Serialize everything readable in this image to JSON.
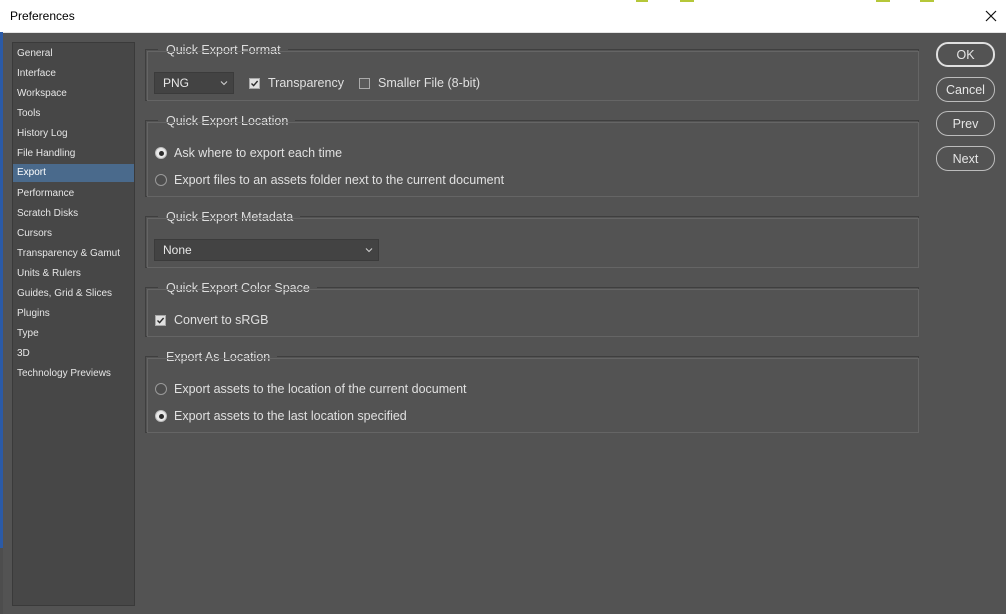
{
  "window": {
    "title": "Preferences"
  },
  "sidebar": {
    "items": [
      {
        "label": "General"
      },
      {
        "label": "Interface"
      },
      {
        "label": "Workspace"
      },
      {
        "label": "Tools"
      },
      {
        "label": "History Log"
      },
      {
        "label": "File Handling"
      },
      {
        "label": "Export"
      },
      {
        "label": "Performance"
      },
      {
        "label": "Scratch Disks"
      },
      {
        "label": "Cursors"
      },
      {
        "label": "Transparency & Gamut"
      },
      {
        "label": "Units & Rulers"
      },
      {
        "label": "Guides, Grid & Slices"
      },
      {
        "label": "Plugins"
      },
      {
        "label": "Type"
      },
      {
        "label": "3D"
      },
      {
        "label": "Technology Previews"
      }
    ],
    "selected": "Export"
  },
  "quick_export_format": {
    "title": "Quick Export Format",
    "format_value": "PNG",
    "transparency_label": "Transparency",
    "transparency_checked": true,
    "smaller_file_label": "Smaller File (8-bit)",
    "smaller_file_checked": false
  },
  "quick_export_location": {
    "title": "Quick Export Location",
    "option_ask": "Ask where to export each time",
    "option_assets": "Export files to an assets folder next to the current document",
    "selected": "ask"
  },
  "quick_export_metadata": {
    "title": "Quick Export Metadata",
    "value": "None"
  },
  "quick_export_color_space": {
    "title": "Quick Export Color Space",
    "convert_label": "Convert to sRGB",
    "convert_checked": true
  },
  "export_as_location": {
    "title": "Export As Location",
    "option_current": "Export assets to the location of the current document",
    "option_last": "Export assets to the last location specified",
    "selected": "last"
  },
  "buttons": {
    "ok": "OK",
    "cancel": "Cancel",
    "prev": "Prev",
    "next": "Next"
  },
  "colors": {
    "panel_bg": "#535353",
    "sidebar_bg": "#474747",
    "selected_item": "#4a6a8c"
  }
}
